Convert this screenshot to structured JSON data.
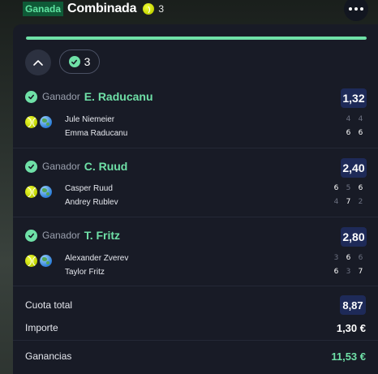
{
  "header": {
    "status": "Ganada",
    "title": "Combinada",
    "count": "3",
    "more_icon": "more-horizontal-icon"
  },
  "colors": {
    "accent_green": "#6fe0a7",
    "odds_bg": "#1e2a58",
    "card_bg": "#181b26"
  },
  "progress": {
    "fraction": 1.0
  },
  "legs_pill": {
    "count": "3"
  },
  "legs": [
    {
      "market": "Ganador",
      "pick": "E. Raducanu",
      "odds": "1,32",
      "players": [
        {
          "name": "Jule Niemeier",
          "scores": [
            "4",
            "4"
          ]
        },
        {
          "name": "Emma Raducanu",
          "scores": [
            "6",
            "6"
          ]
        }
      ]
    },
    {
      "market": "Ganador",
      "pick": "C. Ruud",
      "odds": "2,40",
      "players": [
        {
          "name": "Casper Ruud",
          "scores": [
            "6",
            "5",
            "6"
          ]
        },
        {
          "name": "Andrey Rublev",
          "scores": [
            "4",
            "7",
            "2"
          ]
        }
      ]
    },
    {
      "market": "Ganador",
      "pick": "T. Fritz",
      "odds": "2,80",
      "players": [
        {
          "name": "Alexander Zverev",
          "scores": [
            "3",
            "6",
            "6"
          ]
        },
        {
          "name": "Taylor Fritz",
          "scores": [
            "6",
            "3",
            "7"
          ]
        }
      ]
    }
  ],
  "summary": {
    "total_odds_label": "Cuota total",
    "total_odds": "8,87",
    "stake_label": "Importe",
    "stake": "1,30 €",
    "winnings_label": "Ganancias",
    "winnings": "11,53 €"
  }
}
